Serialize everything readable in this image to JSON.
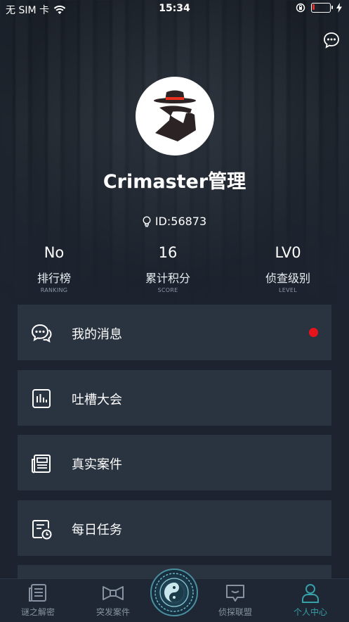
{
  "status_bar": {
    "carrier": "无 SIM 卡",
    "time": "15:34"
  },
  "profile": {
    "username": "Crimaster管理",
    "id_text": "ID:56873"
  },
  "stats": [
    {
      "value": "No",
      "label": "排行榜",
      "sub": "RANKING"
    },
    {
      "value": "16",
      "label": "累计积分",
      "sub": "SCORE"
    },
    {
      "value": "LV0",
      "label": "侦查级别",
      "sub": "LEVEL"
    }
  ],
  "menu": [
    {
      "label": "我的消息",
      "icon": "message-icon",
      "has_badge": true
    },
    {
      "label": "吐槽大会",
      "icon": "chart-board-icon",
      "has_badge": false
    },
    {
      "label": "真实案件",
      "icon": "newspaper-icon",
      "has_badge": false
    },
    {
      "label": "每日任务",
      "icon": "calendar-clock-icon",
      "has_badge": false
    }
  ],
  "tabbar": {
    "items": [
      {
        "label": "谜之解密",
        "icon": "document-icon",
        "active": false
      },
      {
        "label": "突发案件",
        "icon": "bowtie-icon",
        "active": false
      },
      {
        "label": "",
        "icon": "yin-yang-icon",
        "active": false
      },
      {
        "label": "侦探联盟",
        "icon": "chat-box-icon",
        "active": false
      },
      {
        "label": "个人中心",
        "icon": "person-icon",
        "active": true
      }
    ]
  },
  "colors": {
    "background": "#1d2430",
    "card": "#2a3340",
    "badge_red": "#e8141c",
    "active_tab": "#35a0a8"
  }
}
